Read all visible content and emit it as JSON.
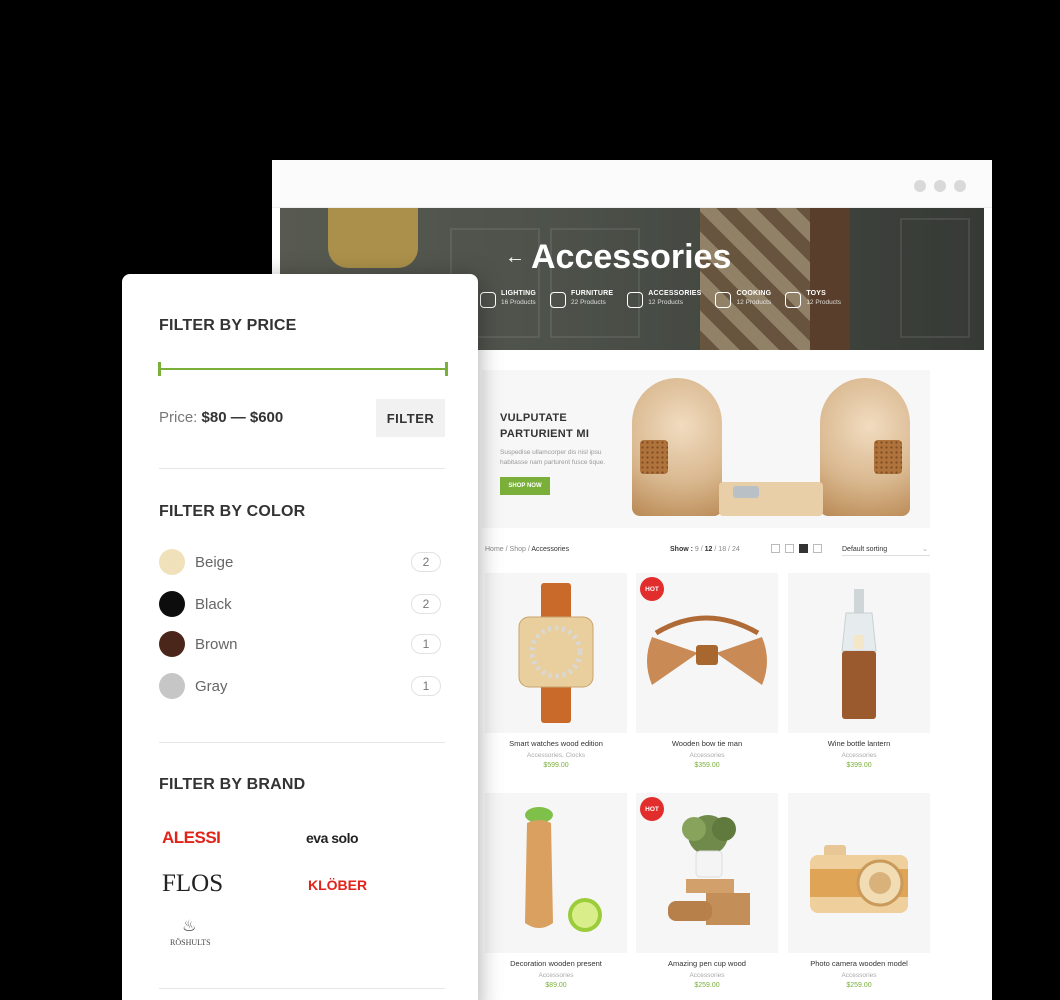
{
  "browser": {
    "hero": {
      "title": "Accessories",
      "back_arrow": "←",
      "categories": [
        {
          "name": "LIGHTING",
          "count": "16 Products",
          "icon": "lamp-icon"
        },
        {
          "name": "FURNITURE",
          "count": "22 Products",
          "icon": "chair-icon"
        },
        {
          "name": "ACCESSORIES",
          "count": "12 Products",
          "icon": "plant-icon"
        },
        {
          "name": "COOKING",
          "count": "12 Products",
          "icon": "utensils-icon"
        },
        {
          "name": "TOYS",
          "count": "12 Products",
          "icon": "rocking-horse-icon"
        }
      ]
    },
    "banner": {
      "heading": "VULPUTATE PARTURIENT MI",
      "text": "Suspedise ullamcorper dis nisl ipsu habitasse nam parturent fusce tique.",
      "button": "SHOP NOW"
    },
    "toolbar": {
      "breadcrumb": {
        "home": "Home",
        "sep1": " / ",
        "shop": "Shop",
        "sep2": " / ",
        "current": "Accessories"
      },
      "show_label": "Show :",
      "show_options": [
        "9",
        "12",
        "18",
        "24"
      ],
      "show_active": "12",
      "sort": "Default sorting"
    },
    "products": [
      {
        "name": "Smart watches wood edition",
        "category": "Accessories, Clocks",
        "price": "$599.00",
        "hot": false
      },
      {
        "name": "Wooden bow tie man",
        "category": "Accessories",
        "price": "$359.00",
        "hot": true
      },
      {
        "name": "Wine bottle lantern",
        "category": "Accessories",
        "price": "$399.00",
        "hot": false
      },
      {
        "name": "Decoration wooden present",
        "category": "Accessories",
        "price": "$89.00",
        "hot": false
      },
      {
        "name": "Amazing pen cup wood",
        "category": "Accessories",
        "price": "$259.00",
        "hot": true
      },
      {
        "name": "Photo camera wooden model",
        "category": "Accessories",
        "price": "$259.00",
        "hot": false
      }
    ],
    "hot_label": "HOT"
  },
  "sidebar": {
    "price": {
      "title": "FILTER BY PRICE",
      "label": "Price:",
      "range": "$80 — $600",
      "button": "FILTER"
    },
    "color": {
      "title": "FILTER BY COLOR",
      "items": [
        {
          "name": "Beige",
          "count": "2",
          "hex": "#f0e1bb"
        },
        {
          "name": "Black",
          "count": "2",
          "hex": "#0d0d0d"
        },
        {
          "name": "Brown",
          "count": "1",
          "hex": "#4a261a"
        },
        {
          "name": "Gray",
          "count": "1",
          "hex": "#c6c6c6"
        }
      ]
    },
    "brand": {
      "title": "FILTER BY BRAND",
      "items": [
        "ALESSI",
        "eva solo",
        "FLOS",
        "KLÖBER",
        "RÖSHULTS"
      ]
    }
  },
  "colors": {
    "accent": "#7ab03a",
    "hot": "#e22d2d"
  }
}
